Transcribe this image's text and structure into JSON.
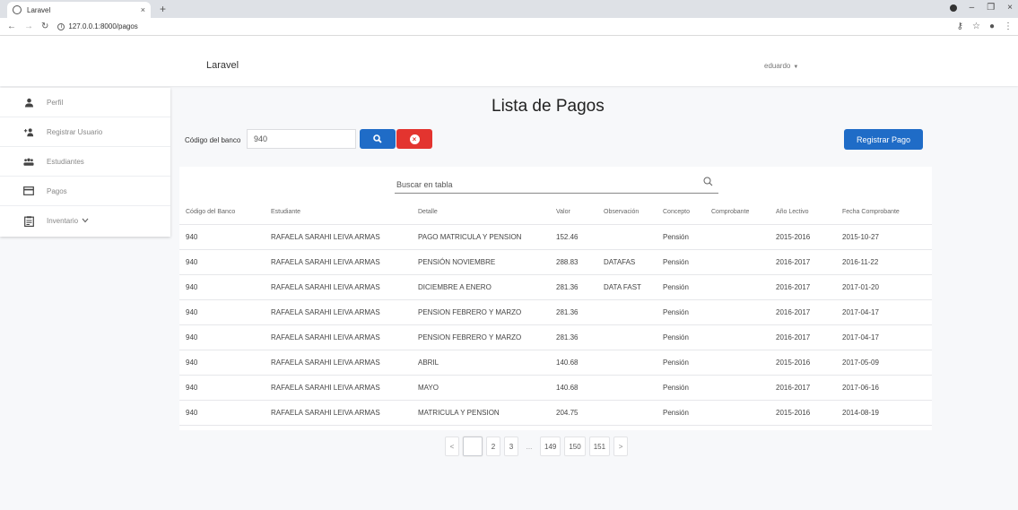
{
  "browser": {
    "tab_title": "Laravel",
    "tab_close": "×",
    "new_tab": "+",
    "url": "127.0.0.1:8000/pagos",
    "window_controls": [
      "–",
      "❐",
      "×"
    ]
  },
  "header": {
    "brand": "Laravel",
    "user": "eduardo"
  },
  "sidebar": {
    "items": [
      {
        "label": "Perfil",
        "icon": "person-icon"
      },
      {
        "label": "Registrar Usuario",
        "icon": "add-user-icon"
      },
      {
        "label": "Estudiantes",
        "icon": "group-icon"
      },
      {
        "label": "Pagos",
        "icon": "card-icon"
      },
      {
        "label": "Inventario",
        "icon": "clipboard-icon",
        "has_dropdown": true
      }
    ]
  },
  "main": {
    "title": "Lista de Pagos",
    "code_label": "Código del banco",
    "code_value": "940",
    "register_button": "Registrar Pago",
    "table_search_placeholder": "Buscar en tabla",
    "colors": {
      "primary": "#1f6cc7",
      "danger": "#e3342f"
    }
  },
  "table": {
    "headers": [
      "Código del Banco",
      "Estudiante",
      "Detalle",
      "Valor",
      "Observación",
      "Concepto",
      "Comprobante",
      "Año Lectivo",
      "Fecha Comprobante"
    ],
    "rows": [
      [
        "940",
        "RAFAELA SARAHI LEIVA ARMAS",
        "PAGO MATRICULA Y PENSION",
        "152.46",
        "",
        "Pensión",
        "",
        "2015-2016",
        "2015-10-27"
      ],
      [
        "940",
        "RAFAELA SARAHI LEIVA ARMAS",
        "PENSIÓN NOVIEMBRE",
        "288.83",
        "DATAFAS",
        "Pensión",
        "",
        "2016-2017",
        "2016-11-22"
      ],
      [
        "940",
        "RAFAELA SARAHI LEIVA ARMAS",
        "DICIEMBRE A ENERO",
        "281.36",
        "DATA FAST",
        "Pensión",
        "",
        "2016-2017",
        "2017-01-20"
      ],
      [
        "940",
        "RAFAELA SARAHI LEIVA ARMAS",
        "PENSION FEBRERO Y MARZO",
        "281.36",
        "",
        "Pensión",
        "",
        "2016-2017",
        "2017-04-17"
      ],
      [
        "940",
        "RAFAELA SARAHI LEIVA ARMAS",
        "PENSION FEBRERO Y MARZO",
        "281.36",
        "",
        "Pensión",
        "",
        "2016-2017",
        "2017-04-17"
      ],
      [
        "940",
        "RAFAELA SARAHI LEIVA ARMAS",
        "ABRIL",
        "140.68",
        "",
        "Pensión",
        "",
        "2015-2016",
        "2017-05-09"
      ],
      [
        "940",
        "RAFAELA SARAHI LEIVA ARMAS",
        "MAYO",
        "140.68",
        "",
        "Pensión",
        "",
        "2016-2017",
        "2017-06-16"
      ],
      [
        "940",
        "RAFAELA SARAHI LEIVA ARMAS",
        "MATRICULA Y PENSION",
        "204.75",
        "",
        "Pensión",
        "",
        "2015-2016",
        "2014-08-19"
      ]
    ]
  },
  "pagination": {
    "prev": "<",
    "pages": [
      "",
      "2",
      "3",
      "...",
      "149",
      "150",
      "151"
    ],
    "active_index": 0,
    "next": ">"
  }
}
